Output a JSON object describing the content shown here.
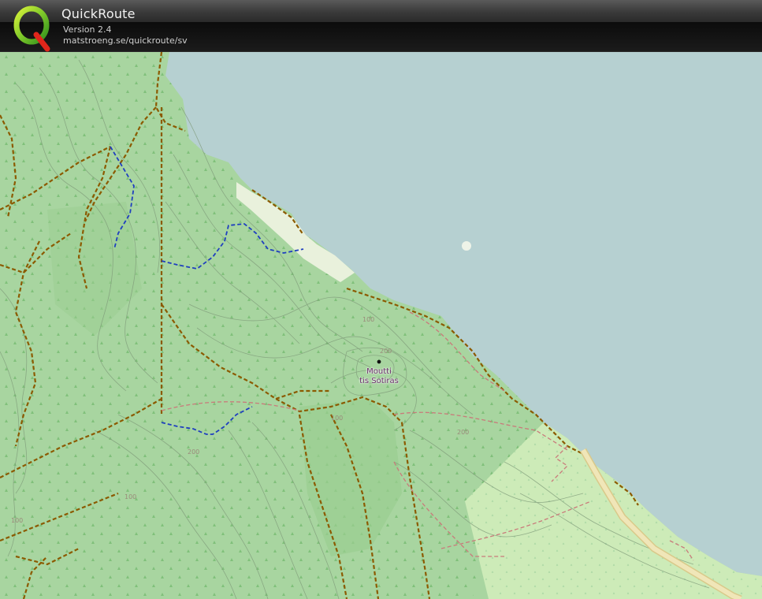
{
  "app": {
    "title": "QuickRoute",
    "version": "Version 2.4",
    "url": "matstroeng.se/quickroute/sv",
    "logo_letter": "Q"
  },
  "map": {
    "peak_label_line1": "Moutti",
    "peak_label_line2": "tis Sotiras",
    "contour_labels": [
      "100",
      "200",
      "200",
      "100",
      "100",
      "200",
      "100"
    ],
    "colors": {
      "sea": "#b6d0d1",
      "forest": "#a8d5a0",
      "forest_dark": "#9acd90",
      "meadow": "#cdebb8",
      "track": "#8b5a00",
      "route": "#1f3fbf",
      "path_red": "#c97b7b",
      "road": "#f0e6b8"
    },
    "icons": [
      "tree-symbol",
      "peak-marker-icon"
    ]
  }
}
